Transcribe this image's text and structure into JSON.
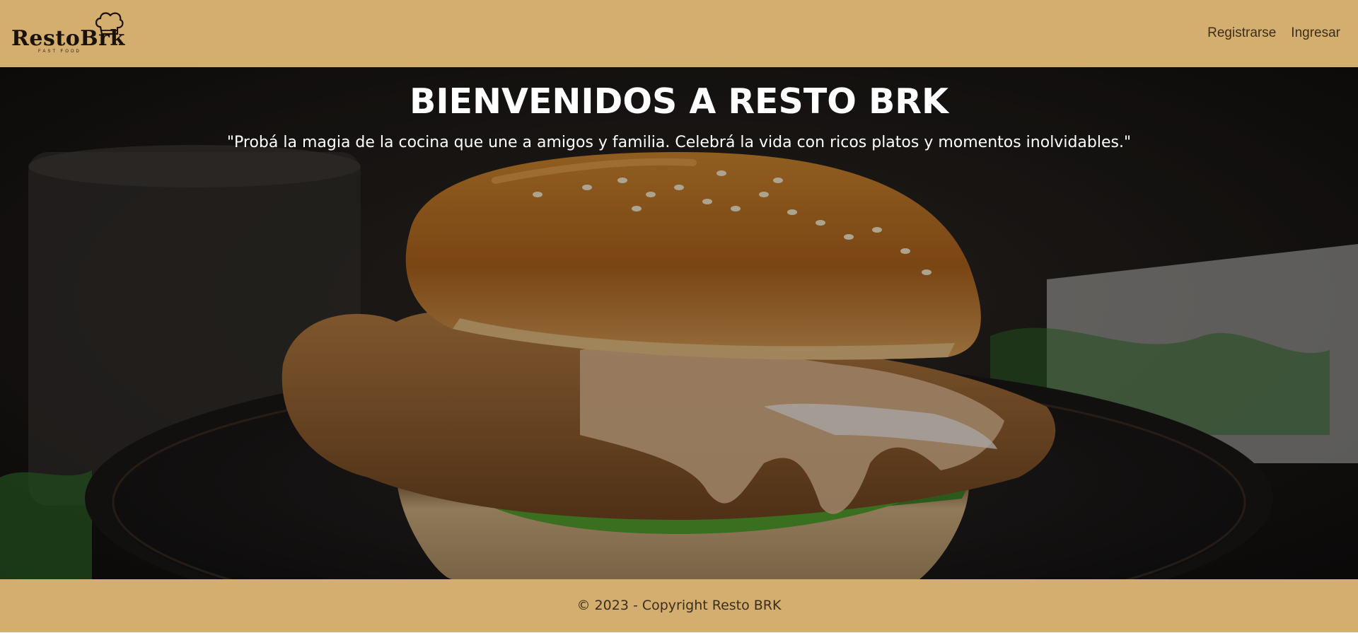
{
  "brand": {
    "logo_text": "RestoBrk",
    "tagline": "FAST FOOD",
    "icon": "chef-hat-icon"
  },
  "nav": {
    "items": [
      {
        "label": "Registrarse"
      },
      {
        "label": "Ingresar"
      }
    ]
  },
  "hero": {
    "title": "BIENVENIDOS A RESTO BRK",
    "quote": "\"Probá la magia de la cocina que une a amigos y familia. Celebrá la vida con ricos platos y momentos inolvidables.\""
  },
  "footer": {
    "copyright": "© 2023 - Copyright Resto BRK"
  },
  "colors": {
    "header_bg": "#d4ae6f",
    "footer_bg": "#d4ae6f",
    "text_dark": "#3b2e1c",
    "hero_text": "#ffffff"
  }
}
